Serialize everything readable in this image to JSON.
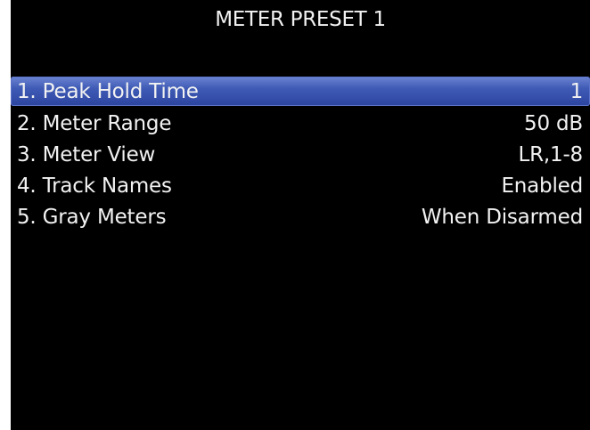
{
  "screen": {
    "title": "METER PRESET 1"
  },
  "menu": {
    "selected_index": 0,
    "items": [
      {
        "label": "1. Peak Hold Time",
        "value": "1"
      },
      {
        "label": "2. Meter Range",
        "value": "50 dB"
      },
      {
        "label": "3. Meter View",
        "value": "LR,1-8"
      },
      {
        "label": "4. Track Names",
        "value": "Enabled"
      },
      {
        "label": "5. Gray Meters",
        "value": "When Disarmed"
      }
    ]
  },
  "colors": {
    "background": "#000000",
    "text": "#f2f2f2",
    "selection": "#3f5bb5"
  }
}
